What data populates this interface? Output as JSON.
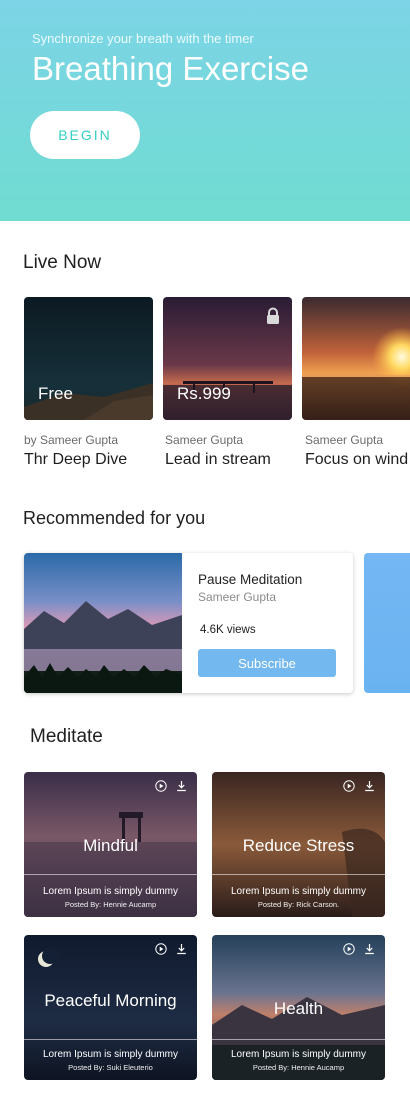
{
  "header": {
    "subtitle": "Synchronize your breath with the timer",
    "title": "Breathing Exercise",
    "begin_label": "BEGIN"
  },
  "live_now": {
    "title": "Live Now",
    "cards": [
      {
        "price": "Free",
        "author": "by Sameer Gupta",
        "name": "Thr Deep Dive",
        "locked": false
      },
      {
        "price": "Rs.999",
        "author": "Sameer Gupta",
        "name": "Lead in stream",
        "locked": true
      },
      {
        "price": "",
        "author": "Sameer Gupta",
        "name": "Focus on wind",
        "locked": false
      }
    ]
  },
  "recommended": {
    "title": "Recommended for you",
    "card": {
      "title": "Pause Meditation",
      "author": "Sameer Gupta",
      "views": "4.6K views",
      "subscribe_label": "Subscribe"
    }
  },
  "meditate": {
    "title": "Meditate",
    "cards": [
      {
        "name": "Mindful",
        "desc": "Lorem Ipsum is simply dummy",
        "poster": "Posted By: Hennie Aucamp"
      },
      {
        "name": "Reduce Stress",
        "desc": "Lorem Ipsum is simply dummy",
        "poster": "Posted By: Rick Carson."
      },
      {
        "name": "Peaceful Morning",
        "desc": "Lorem Ipsum is simply dummy",
        "poster": "Posted By: Suki Eleuterio"
      },
      {
        "name": "Health",
        "desc": "Lorem Ipsum is simply dummy",
        "poster": "Posted By: Hennie Aucamp"
      }
    ]
  },
  "colors": {
    "hero_start": "#7cd4e6",
    "hero_end": "#70dcd1",
    "accent": "#35cfc3",
    "subscribe": "#73b8ef"
  }
}
